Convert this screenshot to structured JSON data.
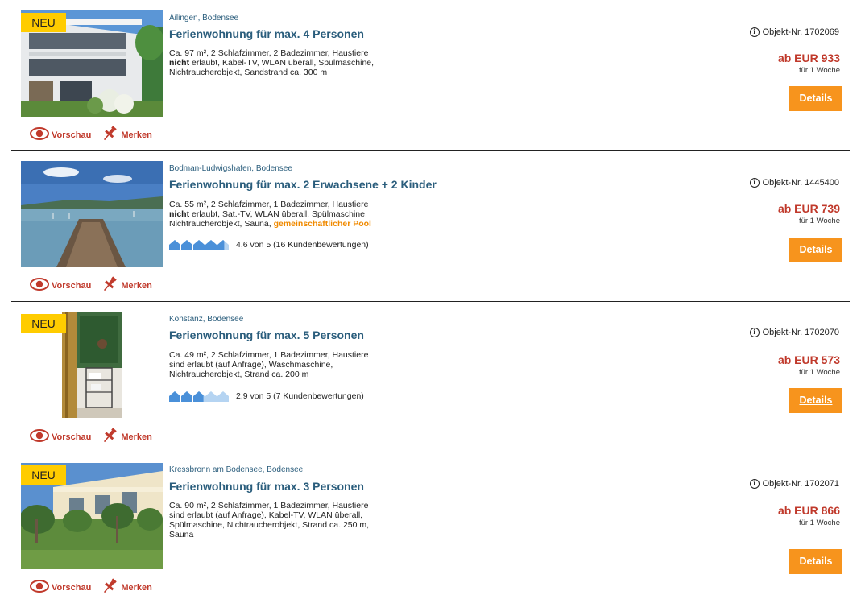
{
  "actions": {
    "preview": "Vorschau",
    "remember": "Merken"
  },
  "listings": [
    {
      "badge": "NEU",
      "location": "Ailingen, Bodensee",
      "title": "Ferienwohnung für max. 4 Personen",
      "desc_1": "Ca. 97 m², 2 Schlafzimmer, 2 Badezimmer, Haustiere",
      "desc_2_bold": "nicht",
      "desc_2": " erlaubt, Kabel-TV, WLAN überall, Spülmaschine,",
      "desc_3": "Nichtraucherobjekt, Sandstrand ca. 300 m",
      "object_label": "Objekt-Nr. 1702069",
      "price": "ab EUR 933",
      "per": "für 1 Woche",
      "details": "Details"
    },
    {
      "location": "Bodman-Ludwigshafen, Bodensee",
      "title": "Ferienwohnung für max. 2 Erwachsene + 2 Kinder",
      "desc_1": "Ca. 55 m², 2 Schlafzimmer, 1 Badezimmer, Haustiere",
      "desc_2_bold": "nicht",
      "desc_2": " erlaubt, Sat.-TV, WLAN überall, Spülmaschine,",
      "desc_3": "Nichtraucherobjekt, Sauna, ",
      "desc_highlight": "gemeinschaftlicher Pool",
      "rating_value": 4.6,
      "rating_text": "4,6 von 5 (16 Kundenbewertungen)",
      "object_label": "Objekt-Nr. 1445400",
      "price": "ab EUR 739",
      "per": "für 1 Woche",
      "details": "Details"
    },
    {
      "badge": "NEU",
      "location": "Konstanz, Bodensee",
      "title": "Ferienwohnung für max. 5 Personen",
      "desc_1": "Ca. 49 m², 2 Schlafzimmer, 1 Badezimmer, Haustiere",
      "desc_2": "sind erlaubt (auf Anfrage), Waschmaschine,",
      "desc_3": "Nichtraucherobjekt, Strand ca. 200 m",
      "rating_value": 2.9,
      "rating_text": "2,9 von 5 (7 Kundenbewertungen)",
      "object_label": "Objekt-Nr. 1702070",
      "price": "ab EUR 573",
      "per": "für 1 Woche",
      "details": "Details"
    },
    {
      "badge": "NEU",
      "location": "Kressbronn am Bodensee, Bodensee",
      "title": "Ferienwohnung für max. 3 Personen",
      "desc_1": "Ca. 90 m², 2 Schlafzimmer, 1 Badezimmer, Haustiere",
      "desc_2": "sind erlaubt (auf Anfrage), Kabel-TV, WLAN überall,",
      "desc_3": "Spülmaschine, Nichtraucherobjekt, Strand ca. 250 m,",
      "desc_4": "Sauna",
      "object_label": "Objekt-Nr. 1702071",
      "price": "ab EUR 866",
      "per": "für 1 Woche",
      "details": "Details"
    }
  ]
}
